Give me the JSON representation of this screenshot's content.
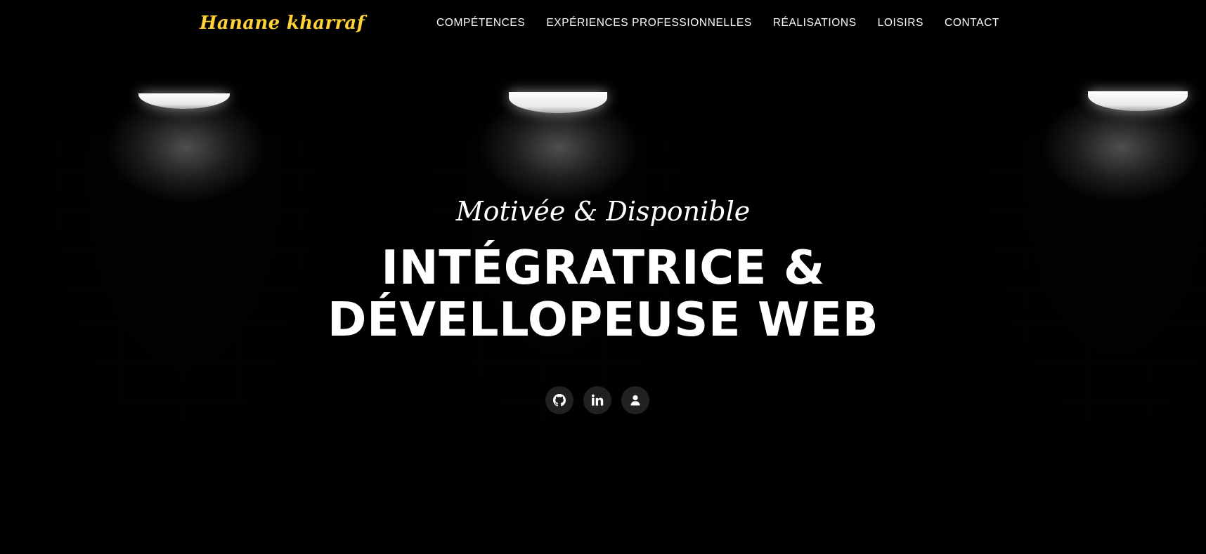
{
  "brand": {
    "name": "Hanane kharraf",
    "color": "#fed136"
  },
  "nav": {
    "items": [
      {
        "label": "COMPÉTENCES"
      },
      {
        "label": "EXPÉRIENCES PROFESSIONNELLES"
      },
      {
        "label": "RÉALISATIONS"
      },
      {
        "label": "LOISIRS"
      },
      {
        "label": "CONTACT"
      }
    ]
  },
  "hero": {
    "lead": "Motivée & Disponible",
    "heading": "INTÉGRATRICE & DÉVELLOPEUSE WEB",
    "background": "dark-brick-wall-with-lamps"
  },
  "social": {
    "icons": [
      "github-icon",
      "linkedin-icon",
      "user-icon"
    ],
    "button_color": "#212121"
  }
}
